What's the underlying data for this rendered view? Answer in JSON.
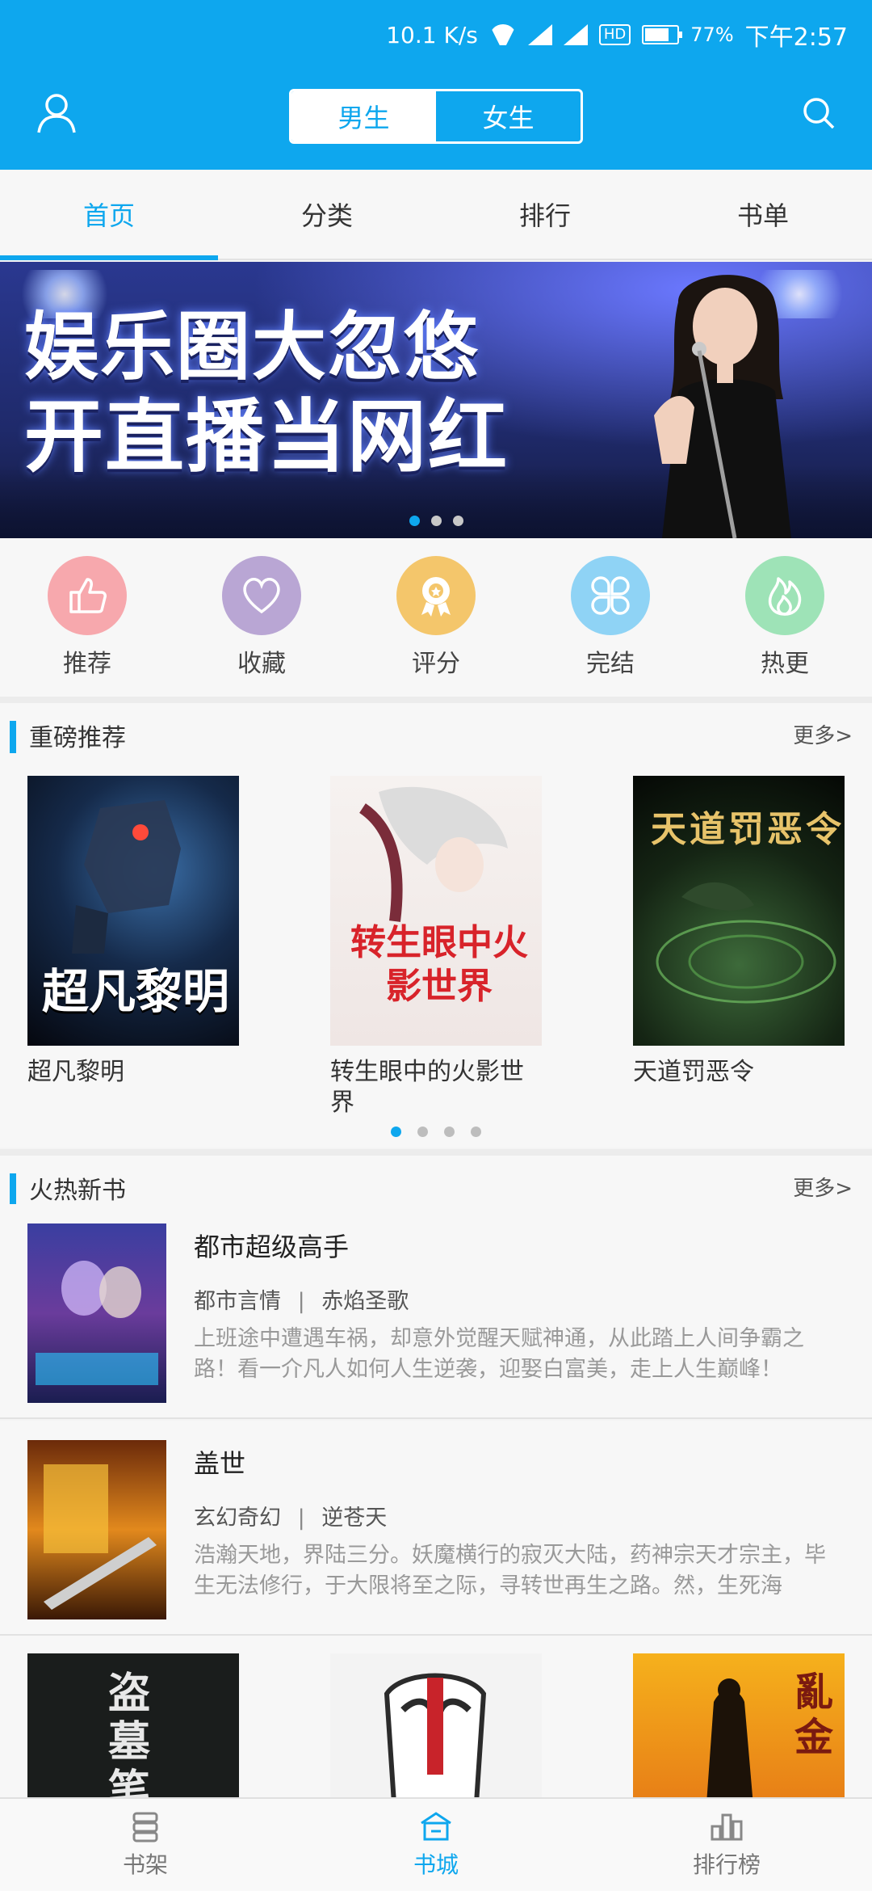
{
  "status_bar": {
    "speed": "10.1 K/s",
    "net1": "4G",
    "net2": "4G",
    "hd": "HD",
    "battery": "77%",
    "battery_level": 0.77,
    "time": "下午2:57"
  },
  "header": {
    "gender_tabs": [
      "男生",
      "女生"
    ],
    "selected_gender": "男生",
    "accent_color": "#0ea7ee"
  },
  "tabs": [
    {
      "label": "首页",
      "active": true
    },
    {
      "label": "分类",
      "active": false
    },
    {
      "label": "排行",
      "active": false
    },
    {
      "label": "书单",
      "active": false
    }
  ],
  "banner": {
    "line1": "娱乐圈大忽悠",
    "line2": "开直播当网红",
    "slide_count": 3,
    "current_slide": 1
  },
  "categories": [
    {
      "label": "推荐",
      "icon": "thumbs-up-icon",
      "color": "#f7a8ad"
    },
    {
      "label": "收藏",
      "icon": "heart-icon",
      "color": "#b9a6d4"
    },
    {
      "label": "评分",
      "icon": "award-icon",
      "color": "#f4c66b"
    },
    {
      "label": "完结",
      "icon": "clover-icon",
      "color": "#8fd3f5"
    },
    {
      "label": "热更",
      "icon": "flame-icon",
      "color": "#9ee3b7"
    }
  ],
  "featured": {
    "title": "重磅推荐",
    "more": "更多>",
    "books": [
      {
        "name": "超凡黎明",
        "cover_text": "超凡黎明"
      },
      {
        "name": "转生眼中的火影世界",
        "cover_text": "转生眼中火影世界"
      },
      {
        "name": "天道罚恶令",
        "cover_text": "天道罚恶令"
      }
    ],
    "page_count": 4,
    "current_page": 1
  },
  "hot_new": {
    "title": "火热新书",
    "more": "更多>",
    "items": [
      {
        "title": "都市超级高手",
        "category": "都市言情",
        "sep": "|",
        "author": "赤焰圣歌",
        "desc": "上班途中遭遇车祸，却意外觉醒天赋神通，从此踏上人间争霸之路！看一介凡人如何人生逆袭，迎娶白富美，走上人生巅峰！【微..."
      },
      {
        "title": "盖世",
        "category": "玄幻奇幻",
        "sep": "|",
        "author": "逆苍天",
        "desc": "浩瀚天地，界陆三分。妖魔横行的寂灭大陆，药神宗天才宗主，毕生无法修行，于大限将至之际，寻转世再生之路。然，生死海深，..."
      }
    ]
  },
  "row3_covers": [
    "盗墓笔",
    "",
    "亂金"
  ],
  "bottom_nav": [
    {
      "label": "书架",
      "icon": "bookshelf-icon",
      "active": false
    },
    {
      "label": "书城",
      "icon": "bookstore-icon",
      "active": true
    },
    {
      "label": "排行榜",
      "icon": "ranking-icon",
      "active": false
    }
  ]
}
